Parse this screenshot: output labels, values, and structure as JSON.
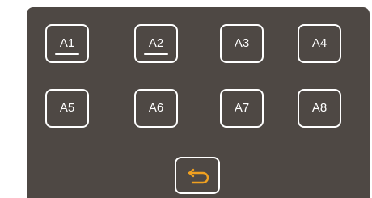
{
  "slots": [
    {
      "label": "A1",
      "selected": true
    },
    {
      "label": "A2",
      "selected": true
    },
    {
      "label": "A3",
      "selected": false
    },
    {
      "label": "A4",
      "selected": false
    },
    {
      "label": "A5",
      "selected": false
    },
    {
      "label": "A6",
      "selected": false
    },
    {
      "label": "A7",
      "selected": false
    },
    {
      "label": "A8",
      "selected": false
    }
  ],
  "back_button": {
    "icon": "return-arrow-icon"
  },
  "colors": {
    "panel": "#4e4844",
    "outline": "#ffffff",
    "accent": "#f0a020"
  }
}
